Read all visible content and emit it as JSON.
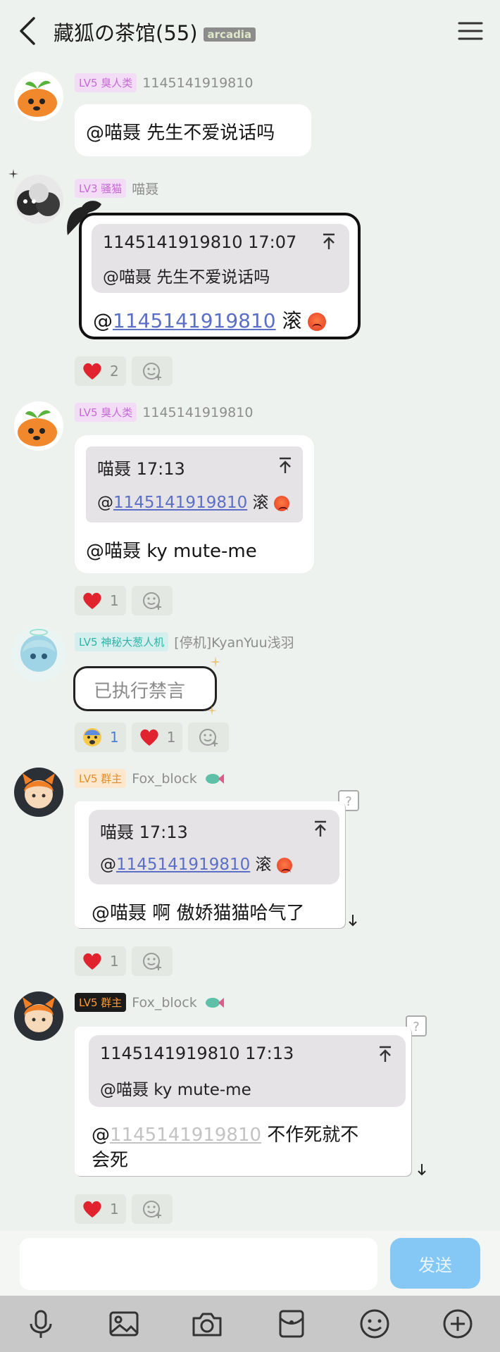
{
  "header": {
    "title": "藏狐の茶馆(55)",
    "badge": "arcadia"
  },
  "messages": [
    {
      "level": "LV5 臭人类",
      "name": "1145141919810",
      "text": "@喵聂 先生不爱说话吗"
    },
    {
      "level": "LV3 骚猫",
      "name": "喵聂",
      "quote": {
        "head": "1145141919810 17:07",
        "text": "@喵聂 先生不爱说话吗"
      },
      "mention": "1145141919810",
      "suffix": " 滚",
      "reactions": [
        {
          "icon": "heart-icon",
          "count": "2"
        }
      ]
    },
    {
      "level": "LV5 臭人类",
      "name": "1145141919810",
      "quote": {
        "head": "喵聂 17:13",
        "mention": "1145141919810",
        "suffix": " 滚"
      },
      "text": "@喵聂 ky mute-me",
      "reactions": [
        {
          "icon": "heart-icon",
          "count": "1"
        }
      ]
    },
    {
      "level": "LV5 神秘大葱人机",
      "name": "[停机]KyanYuu浅羽",
      "text": "已执行禁言",
      "reactions": [
        {
          "icon": "fearful-face-icon",
          "count": "1"
        },
        {
          "icon": "heart-icon",
          "count": "1"
        }
      ]
    },
    {
      "level": "LV5 群主",
      "name": "Fox_block",
      "quote": {
        "head": "喵聂 17:13",
        "mention": "1145141919810",
        "suffix": " 滚"
      },
      "text": "@喵聂 啊 傲娇猫猫哈气了",
      "reactions": [
        {
          "icon": "heart-icon",
          "count": "1"
        }
      ]
    },
    {
      "level": "LV5 群主",
      "name": "Fox_block",
      "quote": {
        "head": "1145141919810 17:13",
        "text": "@喵聂 ky mute-me"
      },
      "mention": "1145141919810",
      "line1": " 不作死就不",
      "line2": "会死",
      "reactions": [
        {
          "icon": "heart-icon",
          "count": "1"
        }
      ]
    }
  ],
  "input": {
    "send_label": "发送"
  },
  "colors": {
    "background": "#eef2ee",
    "send": "#86c8f5",
    "link": "#5b6fc7"
  }
}
